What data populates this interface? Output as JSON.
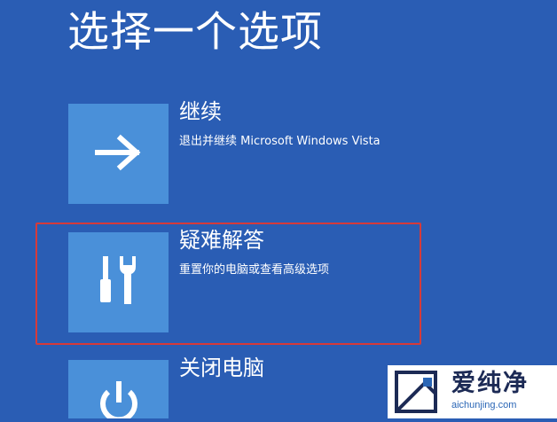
{
  "screen": {
    "title": "选择一个选项",
    "background_color": "#2a5db4",
    "tile_color": "#4a90d9",
    "highlight_color": "#d63a3a"
  },
  "options": [
    {
      "title": "继续",
      "description": "退出并继续 Microsoft Windows Vista",
      "icon": "arrow-right-icon"
    },
    {
      "title": "疑难解答",
      "description": "重置你的电脑或查看高级选项",
      "icon": "tools-icon",
      "highlighted": true
    },
    {
      "title": "关闭电脑",
      "description": "",
      "icon": "power-icon"
    }
  ],
  "watermark": {
    "brand": "爱纯净",
    "url": "aichunjing.com",
    "icon": "brand-logo-icon"
  }
}
